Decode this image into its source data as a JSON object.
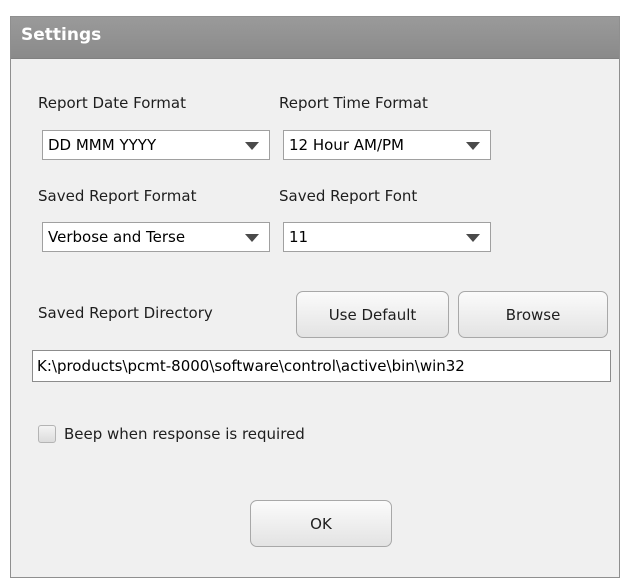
{
  "dialog": {
    "title": "Settings"
  },
  "report_date_format": {
    "label": "Report Date Format",
    "value": "DD MMM YYYY"
  },
  "report_time_format": {
    "label": "Report Time Format",
    "value": "12 Hour AM/PM"
  },
  "saved_report_format": {
    "label": "Saved Report Format",
    "value": "Verbose and Terse"
  },
  "saved_report_font": {
    "label": "Saved Report Font",
    "value": "11"
  },
  "saved_report_directory": {
    "label": "Saved Report Directory",
    "use_default_label": "Use Default",
    "browse_label": "Browse",
    "value": "K:\\products\\pcmt-8000\\software\\control\\active\\bin\\win32"
  },
  "beep": {
    "label": "Beep when response is required",
    "checked": false
  },
  "ok_label": "OK",
  "icons": {
    "dropdown": "chevron-down-icon"
  }
}
